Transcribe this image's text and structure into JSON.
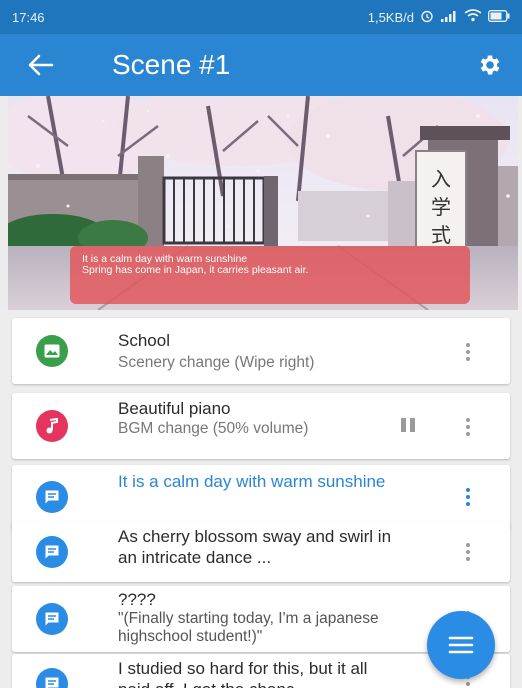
{
  "status_bar": {
    "time": "17:46",
    "network_speed": "1,5KB/d"
  },
  "app_bar": {
    "title": "Scene #1"
  },
  "hero": {
    "caption_line1": "It is a calm day with warm sunshine",
    "caption_line2": "Spring has come in Japan, it carries pleasant air.",
    "sign_text": "入学式"
  },
  "items": [
    {
      "icon": "image-icon",
      "color": "#3a9f4b",
      "title": "School",
      "subtitle": "Scenery change (Wipe right)"
    },
    {
      "icon": "music-note-icon",
      "color": "#e5345e",
      "title": "Beautiful piano",
      "subtitle": "BGM change (50% volume)"
    },
    {
      "icon": "message-icon",
      "color": "#2a8ce4",
      "title": "It is a calm day with warm sunshine",
      "subtitle": ""
    },
    {
      "icon": "message-icon",
      "color": "#2a8ce4",
      "title": "As cherry blossom sway and swirl in an intricate dance ...",
      "subtitle": ""
    },
    {
      "icon": "message-icon",
      "color": "#2a8ce4",
      "title": "????",
      "subtitle": "\"(Finally starting today, I'm a japanese highschool student!)\""
    },
    {
      "icon": "message-icon",
      "color": "#2a8ce4",
      "title": "I studied so hard for this, but it all paid off. I got the chanc",
      "subtitle": ""
    }
  ],
  "colors": {
    "primary": "#2a86d3",
    "status_bar": "#1f76bd",
    "fab": "#2a8ce4",
    "caption_bg": "#e25458"
  }
}
